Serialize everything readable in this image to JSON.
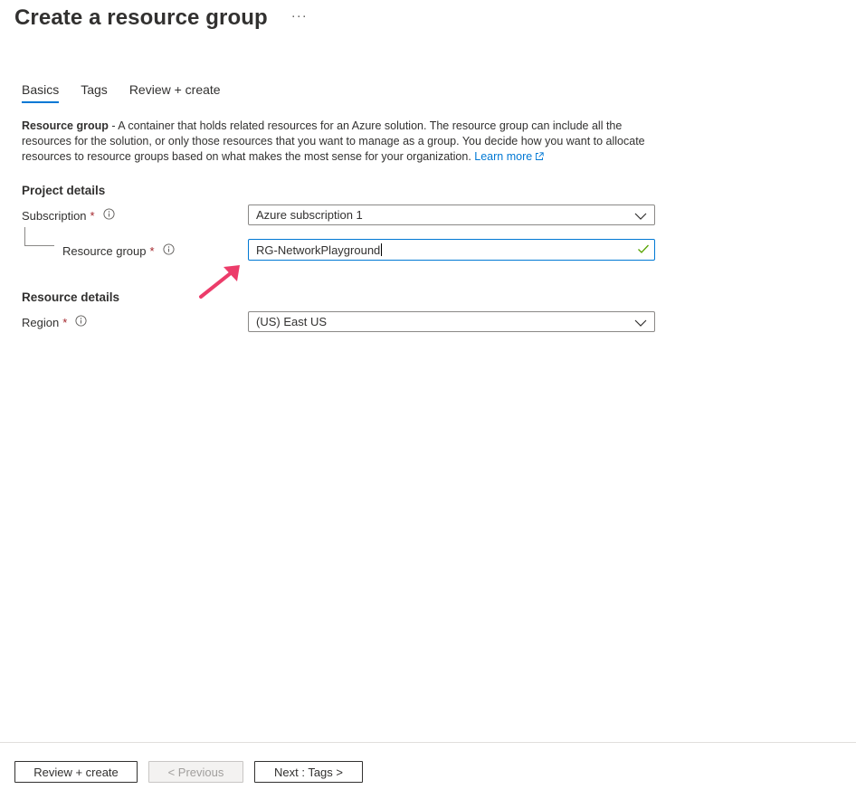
{
  "header": {
    "title": "Create a resource group",
    "more_label": "···"
  },
  "tabs": [
    {
      "label": "Basics",
      "active": true
    },
    {
      "label": "Tags",
      "active": false
    },
    {
      "label": "Review + create",
      "active": false
    }
  ],
  "description": {
    "bold": "Resource group",
    "text": " - A container that holds related resources for an Azure solution. The resource group can include all the resources for the solution, or only those resources that you want to manage as a group. You decide how you want to allocate resources to resource groups based on what makes the most sense for your organization. ",
    "link": "Learn more"
  },
  "project_details": {
    "title": "Project details",
    "subscription": {
      "label": "Subscription",
      "required": "*",
      "value": "Azure subscription 1"
    },
    "resource_group": {
      "label": "Resource group",
      "required": "*",
      "value": "RG-NetworkPlayground"
    }
  },
  "resource_details": {
    "title": "Resource details",
    "region": {
      "label": "Region",
      "required": "*",
      "value": "(US) East US"
    }
  },
  "footer": {
    "review_create": "Review + create",
    "previous": "< Previous",
    "next": "Next : Tags >"
  },
  "colors": {
    "accent": "#0078d4",
    "required": "#a4262c",
    "valid_check": "#57a300",
    "annotation_arrow": "#ec3c6a",
    "text": "#323130"
  },
  "icons": {
    "more": "ellipsis-icon",
    "info": "info-icon",
    "external": "external-link-icon",
    "chevron": "chevron-down-icon",
    "valid": "checkmark-icon",
    "annotation": "annotation-arrow-icon"
  }
}
